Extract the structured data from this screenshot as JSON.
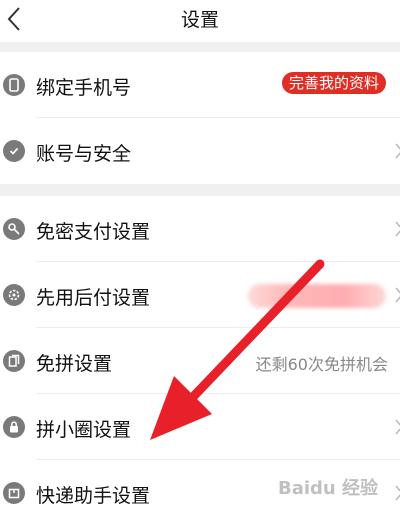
{
  "header": {
    "title": "设置"
  },
  "section1": [
    {
      "label": "绑定手机号",
      "icon": "phone-icon",
      "badge": "完善我的资料"
    },
    {
      "label": "账号与安全",
      "icon": "shield-check-icon"
    }
  ],
  "section2": [
    {
      "label": "免密支付设置",
      "icon": "key-icon"
    },
    {
      "label": "先用后付设置",
      "icon": "gear-badge-icon"
    },
    {
      "label": "免拼设置",
      "icon": "copy-icon",
      "value": "还剩60次免拼机会"
    },
    {
      "label": "拼小圈设置",
      "icon": "lock-icon"
    },
    {
      "label": "快递助手设置",
      "icon": "box-icon"
    }
  ],
  "watermark": "Baidu 经验",
  "colors": {
    "badge": "#e02e24",
    "arrow": "#e8202a",
    "icon": "#7a7a7a",
    "gap": "#f0f0f0"
  }
}
